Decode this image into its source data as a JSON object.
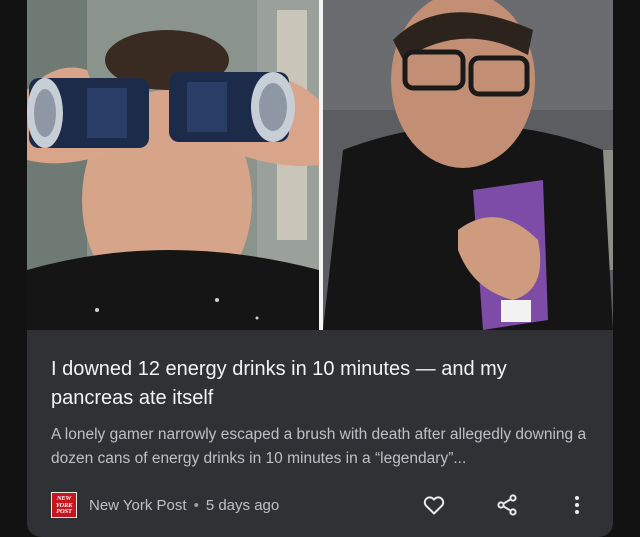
{
  "card": {
    "headline": "I downed 12 energy drinks in 10 minutes — and my pancreas ate itself",
    "snippet": "A lonely gamer narrowly escaped a brush with death after allegedly downing a dozen cans of energy drinks in 10 minutes in a “legendary”...",
    "source": {
      "logo_text_line1": "NEW",
      "logo_text_line2": "YORK",
      "logo_text_line3": "POST",
      "name": "New York Post",
      "separator": "•",
      "age": "5 days ago"
    },
    "actions": {
      "like_icon": "heart-outline-icon",
      "share_icon": "share-icon",
      "more_icon": "more-vertical-icon"
    },
    "images": {
      "left": "man-drinking-two-cans-photo",
      "right": "man-clutching-chest-photo"
    }
  },
  "colors": {
    "page_background": "#121212",
    "card_background": "#303134",
    "headline_text": "#f1f3f4",
    "secondary_text": "#bdc1c6",
    "logo_red": "#c4161c"
  }
}
